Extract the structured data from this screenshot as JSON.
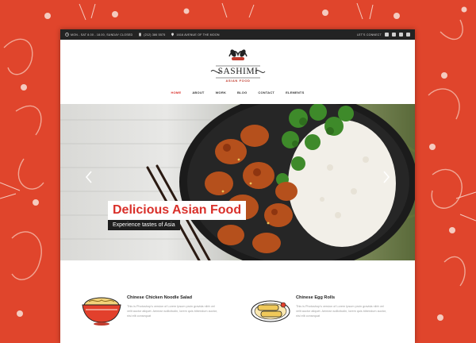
{
  "topbar": {
    "hours": "MON - SAT 8.00 - 18.00, SUNDAY CLOSED",
    "phone": "(212) 386 5575",
    "address": "1616 AVENUE OF THE MOON",
    "connect": "LET'S CONNECT"
  },
  "logo": {
    "name": "SASHIMI",
    "tagline": "ASIAN FOOD"
  },
  "nav": {
    "items": [
      "HOME",
      "ABOUT",
      "WORK",
      "BLOG",
      "CONTACT",
      "ELEMENTS"
    ],
    "active": "HOME"
  },
  "hero": {
    "title": "Delicious Asian Food",
    "subtitle": "Experience tastes of Asia"
  },
  "features": [
    {
      "title": "Chinese Chicken Noodle Salad",
      "description": "This is Photoshop's version of Lorem Ipsum proin gravida nibh vel velit auctor aliquet. Aenean sollicitudin, lorem quis bibendum auctor, nisi elit consequat"
    },
    {
      "title": "Chinese Egg Rolls",
      "description": "This is Photoshop's version of Lorem Ipsum proin gravida nibh vel velit auctor aliquet. Aenean sollicitudin, lorem quis bibendum auctor, nisi elit consequat"
    }
  ],
  "colors": {
    "background_red": "#e0452c",
    "accent": "#d9302a",
    "topbar": "#232323"
  },
  "icons": {
    "clock": "clock-icon",
    "phone": "phone-icon",
    "location": "location-pin-icon",
    "social": [
      "twitter-icon",
      "instagram-icon",
      "facebook-icon",
      "tripadvisor-icon"
    ],
    "prev": "chevron-left-icon",
    "next": "chevron-right-icon"
  }
}
